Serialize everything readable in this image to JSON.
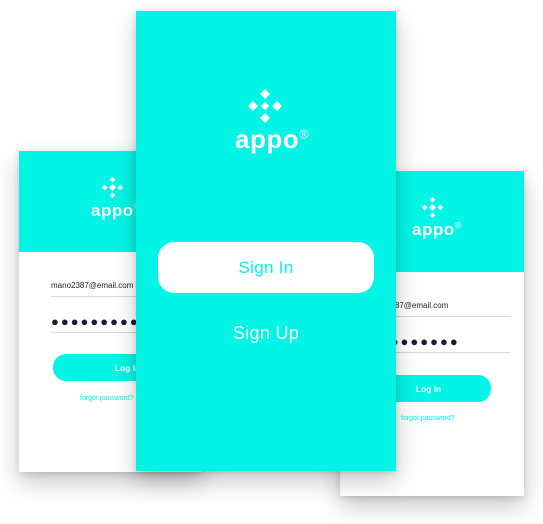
{
  "theme": {
    "accent": "#00f5e6"
  },
  "logo": {
    "icon": "checker-diamond-icon",
    "brand": "appo",
    "trademark": "®"
  },
  "welcome_screen": {
    "sign_in_label": "Sign In",
    "sign_up_label": "Sign Up"
  },
  "login_screen_left": {
    "email_value": "mano2387@email.com",
    "password_mask": "●●●●●●●●●",
    "login_label": "Log In",
    "forgot_label": "forgot password?"
  },
  "login_screen_right": {
    "email_value": "mano2387@email.com",
    "password_mask": "●●●●●●●●●",
    "login_label": "Log In",
    "forgot_label": "forgot password?"
  }
}
